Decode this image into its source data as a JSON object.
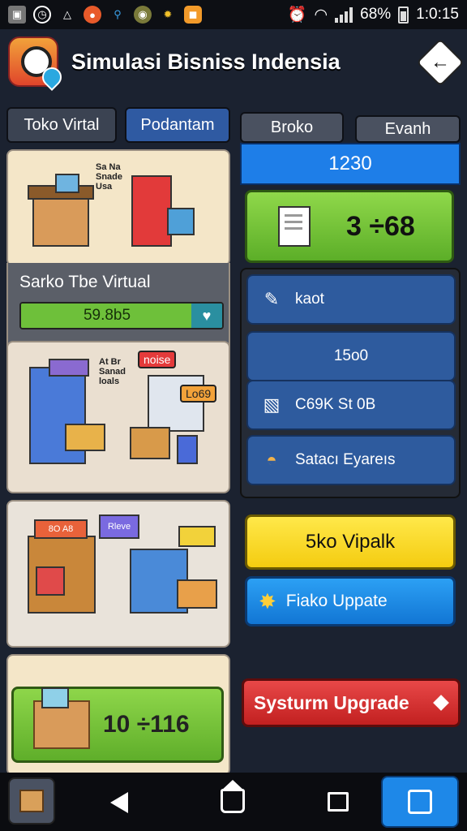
{
  "status_bar": {
    "battery": "68%",
    "time": "1:0:15",
    "icons": [
      "gallery-icon",
      "sync-icon",
      "warning-icon",
      "app-icon-1",
      "key-icon",
      "app-icon-2",
      "gear-icon",
      "app-icon-3"
    ]
  },
  "header": {
    "title": "Simulasi Bisniss Indensia"
  },
  "tabs": {
    "tab1": "Toko Virtal",
    "tab2": "Podantam",
    "tab3": "Broko",
    "tab4": "Evanh"
  },
  "left": {
    "card1_sign": "Sa Na\nSnade\nUsa",
    "store_title": "Sarko Tbe Virtual",
    "progress_value": "59.8b5",
    "progress_fraction": 0.82,
    "card2_sign": "At Br\nSanad\nloals",
    "card2_tag": "noise",
    "card2_tag2": "Lo69",
    "card3_sign1": "8O A8",
    "card3_sign2": "Rleve",
    "big_value": "10 ÷116"
  },
  "right": {
    "header_value": "1230",
    "green_value": "3 ÷68",
    "items": [
      {
        "icon": "tag-icon",
        "label": "kaot"
      },
      {
        "icon": "",
        "label": "15o0"
      },
      {
        "icon": "box-icon",
        "label": "C69K St 0B"
      },
      {
        "icon": "food-icon",
        "label": "Satacı Eyareıs"
      }
    ],
    "yellow_button": "5ko Vipalk",
    "blue_button": "Fiako Uppate",
    "red_button": "Systurm Upgrade"
  }
}
